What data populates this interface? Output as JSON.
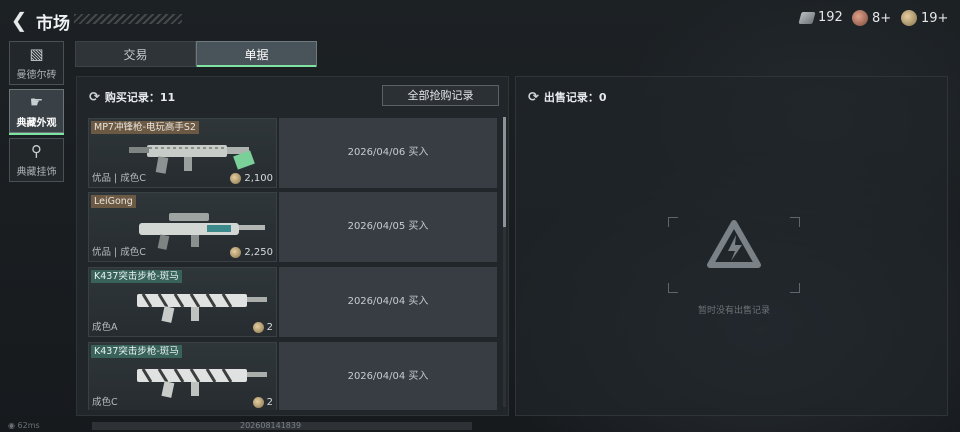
{
  "header": {
    "title": "市场",
    "currencies": [
      {
        "icon": "ticket-icon",
        "value": "192"
      },
      {
        "icon": "token-icon",
        "value": "8+"
      },
      {
        "icon": "coin-icon",
        "value": "19+"
      }
    ]
  },
  "sidebar": {
    "items": [
      {
        "label": "曼德尔砖",
        "icon": "brick-icon",
        "active": false
      },
      {
        "label": "典藏外观",
        "icon": "pistol-icon",
        "active": true
      },
      {
        "label": "典藏挂饰",
        "icon": "charm-icon",
        "active": false
      }
    ]
  },
  "tabs": [
    {
      "label": "交易",
      "active": false
    },
    {
      "label": "单据",
      "active": true
    }
  ],
  "purchase": {
    "title": "购买记录：11",
    "all_button": "全部抢购记录",
    "rows": [
      {
        "name": "MP7冲锋枪-电玩高手S2",
        "grade": "优品 | 成色C",
        "price": "2,100",
        "date": "2026/04/06 买入",
        "tag": "gold"
      },
      {
        "name": "LeiGong",
        "grade": "优品 | 成色C",
        "price": "2,250",
        "date": "2026/04/05 买入",
        "tag": "gold"
      },
      {
        "name": "K437突击步枪-斑马",
        "grade": "成色A",
        "price": "2",
        "date": "2026/04/04 买入",
        "tag": "teal"
      },
      {
        "name": "K437突击步枪-斑马",
        "grade": "成色C",
        "price": "2",
        "date": "2026/04/04 买入",
        "tag": "teal"
      }
    ]
  },
  "sales": {
    "title": "出售记录：0",
    "empty_text": "暂时没有出售记录"
  },
  "footer": {
    "ping": "62ms",
    "build": "202608141839"
  }
}
